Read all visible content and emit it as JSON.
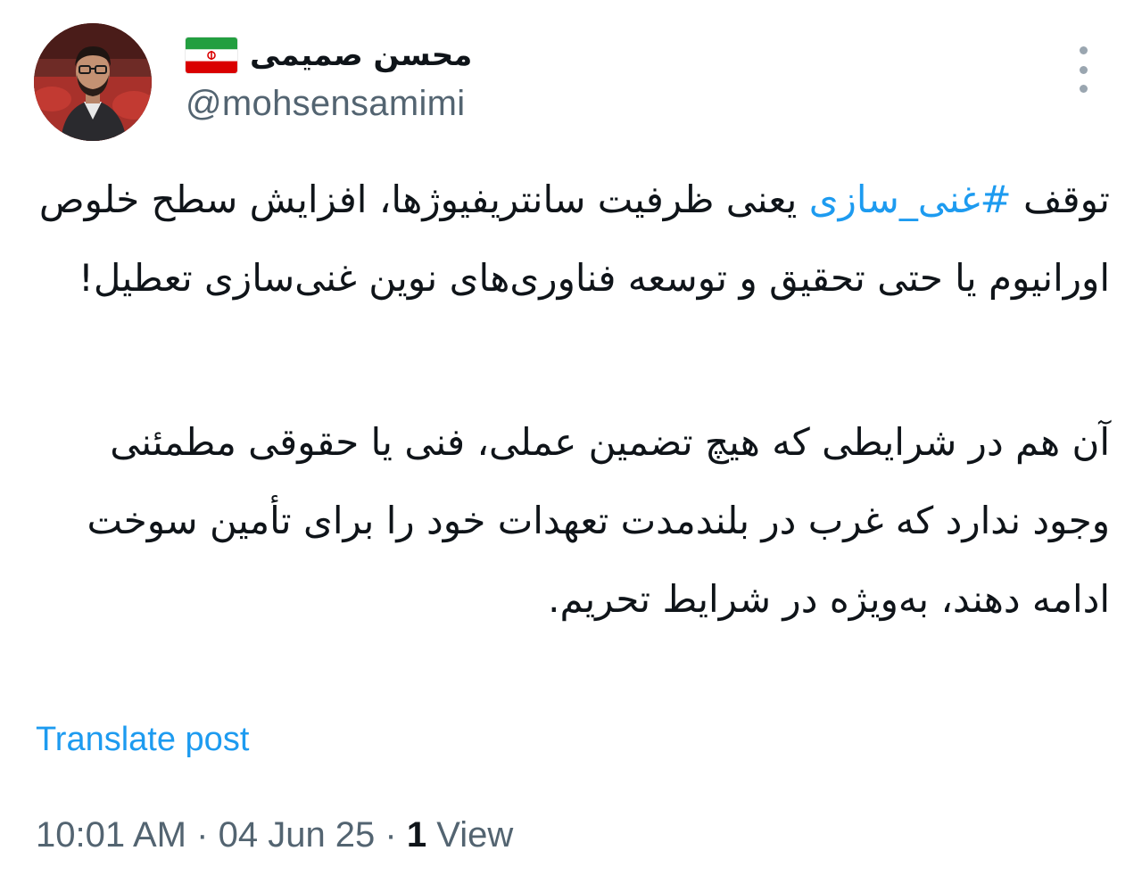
{
  "author": {
    "display_name": "محسن صمیمی",
    "handle": "@mohsensamimi",
    "flag_icon": "iran-flag-icon",
    "avatar_icon": "profile-photo"
  },
  "menu_icon": "more-vertical-icon",
  "tweet": {
    "hashtag": "#غنی_سازی",
    "line1_prefix": "توقف ",
    "line1_suffix": " یعنی ظرفیت سانتریفیوژها، افزایش سطح خلوص اورانیوم یا حتی تحقیق و توسعه فناوری‌های نوین غنی‌سازی تعطیل!",
    "paragraph2": "آن هم در شرایطی که هیچ تضمین عملی، فنی یا حقوقی مطمئنی وجود ندارد که غرب در بلندمدت تعهدات خود را برای تأمین سوخت ادامه دهند، به‌ویژه در شرایط تحریم."
  },
  "translate_label": "Translate post",
  "meta": {
    "time": "10:01 AM",
    "separator": "·",
    "date": "04 Jun 25",
    "views_count": "1",
    "views_label": "View"
  },
  "colors": {
    "link": "#1d9bf0",
    "secondary_text": "#536471",
    "primary_text": "#0f1419"
  }
}
